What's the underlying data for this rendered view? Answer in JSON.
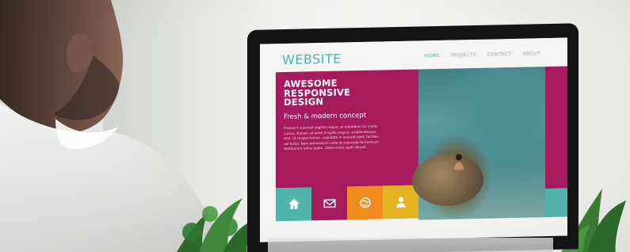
{
  "scene": {
    "type": "photo",
    "subject": "person-looking-at-monitor"
  },
  "website": {
    "logo": "WEBSITE",
    "nav": [
      "HOME",
      "PROJECTS",
      "CONTACT",
      "ABOUT"
    ],
    "hero": {
      "title": "AWESOME\nRESPONSIVE\nDESIGN",
      "subtitle": "Fresh & modern concept",
      "body": "Praesent euismod sagittis neque, at bibendum mi mollis cursus. Nullam sit amet fringilla magna, a pellentesque erat. Ut magna lectus, vulputate in suscipit eget, facilisis vel tortor. Nam elementum nulla id vulputate fermentum. Vestibulum tellus quam, ullamcorper eget aliquet."
    },
    "tiles": [
      {
        "icon": "home-icon",
        "color": "#52b5ad"
      },
      {
        "icon": "mail-icon",
        "color": "#a61a5e"
      },
      {
        "icon": "globe-icon",
        "color": "#f08b1d"
      },
      {
        "icon": "user-icon",
        "color": "#e2b322"
      }
    ]
  },
  "colors": {
    "accent_teal": "#52b5ad",
    "accent_magenta": "#a61a5e",
    "accent_orange": "#f08b1d",
    "accent_yellow": "#e2b322"
  }
}
